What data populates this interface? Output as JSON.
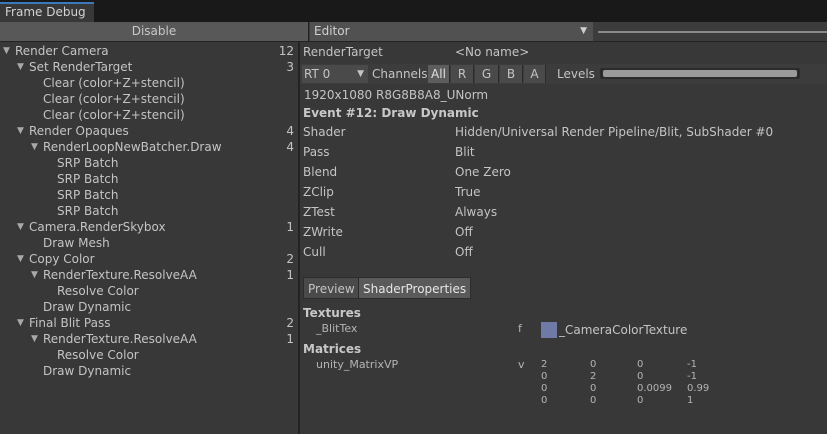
{
  "window": {
    "tab_title": "Frame Debug"
  },
  "toolbar": {
    "disable_label": "Disable",
    "target_dropdown": "Editor"
  },
  "tree": [
    {
      "label": "Render Camera",
      "count": "12",
      "depth": 0,
      "expand": true
    },
    {
      "label": "Set RenderTarget",
      "count": "3",
      "depth": 1,
      "expand": true
    },
    {
      "label": "Clear (color+Z+stencil)",
      "count": "",
      "depth": 2,
      "expand": false
    },
    {
      "label": "Clear (color+Z+stencil)",
      "count": "",
      "depth": 2,
      "expand": false
    },
    {
      "label": "Clear (color+Z+stencil)",
      "count": "",
      "depth": 2,
      "expand": false
    },
    {
      "label": "Render Opaques",
      "count": "4",
      "depth": 1,
      "expand": true
    },
    {
      "label": "RenderLoopNewBatcher.Draw",
      "count": "4",
      "depth": 2,
      "expand": true
    },
    {
      "label": "SRP Batch",
      "count": "",
      "depth": 3,
      "expand": false
    },
    {
      "label": "SRP Batch",
      "count": "",
      "depth": 3,
      "expand": false
    },
    {
      "label": "SRP Batch",
      "count": "",
      "depth": 3,
      "expand": false
    },
    {
      "label": "SRP Batch",
      "count": "",
      "depth": 3,
      "expand": false
    },
    {
      "label": "Camera.RenderSkybox",
      "count": "1",
      "depth": 1,
      "expand": true
    },
    {
      "label": "Draw Mesh",
      "count": "",
      "depth": 2,
      "expand": false
    },
    {
      "label": "Copy Color",
      "count": "2",
      "depth": 1,
      "expand": true
    },
    {
      "label": "RenderTexture.ResolveAA",
      "count": "1",
      "depth": 2,
      "expand": true
    },
    {
      "label": "Resolve Color",
      "count": "",
      "depth": 3,
      "expand": false
    },
    {
      "label": "Draw Dynamic",
      "count": "",
      "depth": 2,
      "expand": false
    },
    {
      "label": "Final Blit Pass",
      "count": "2",
      "depth": 1,
      "expand": true
    },
    {
      "label": "RenderTexture.ResolveAA",
      "count": "1",
      "depth": 2,
      "expand": true
    },
    {
      "label": "Resolve Color",
      "count": "",
      "depth": 3,
      "expand": false
    },
    {
      "label": "Draw Dynamic",
      "count": "",
      "depth": 2,
      "expand": false
    }
  ],
  "details": {
    "render_target_label": "RenderTarget",
    "render_target_value": "<No name>",
    "rt_dropdown": "RT 0",
    "channels_label": "Channels",
    "channels": [
      "All",
      "R",
      "G",
      "B",
      "A"
    ],
    "levels_label": "Levels",
    "resolution": "1920x1080 R8G8B8A8_UNorm",
    "event_title": "Event #12: Draw Dynamic",
    "properties": [
      {
        "name": "Shader",
        "value": "Hidden/Universal Render Pipeline/Blit, SubShader #0"
      },
      {
        "name": "Pass",
        "value": "Blit"
      },
      {
        "name": "Blend",
        "value": "One Zero"
      },
      {
        "name": "ZClip",
        "value": "True"
      },
      {
        "name": "ZTest",
        "value": "Always"
      },
      {
        "name": "ZWrite",
        "value": "Off"
      },
      {
        "name": "Cull",
        "value": "Off"
      }
    ],
    "tabs": [
      "Preview",
      "ShaderProperties"
    ],
    "textures_title": "Textures",
    "texture": {
      "name": "_BlitTex",
      "stage": "f",
      "value": "_CameraColorTexture",
      "swatch_color": "#6f7aa6"
    },
    "matrices_title": "Matrices",
    "matrix": {
      "name": "unity_MatrixVP",
      "stage": "v",
      "rows": [
        [
          "2",
          "0",
          "0",
          "-1"
        ],
        [
          "0",
          "2",
          "0",
          "-1"
        ],
        [
          "0",
          "0",
          "0.0099",
          "0.99"
        ],
        [
          "0",
          "0",
          "0",
          "1"
        ]
      ]
    }
  },
  "colors": {
    "accent": "#3a79bb",
    "panel": "#383838",
    "dark": "#282828"
  }
}
